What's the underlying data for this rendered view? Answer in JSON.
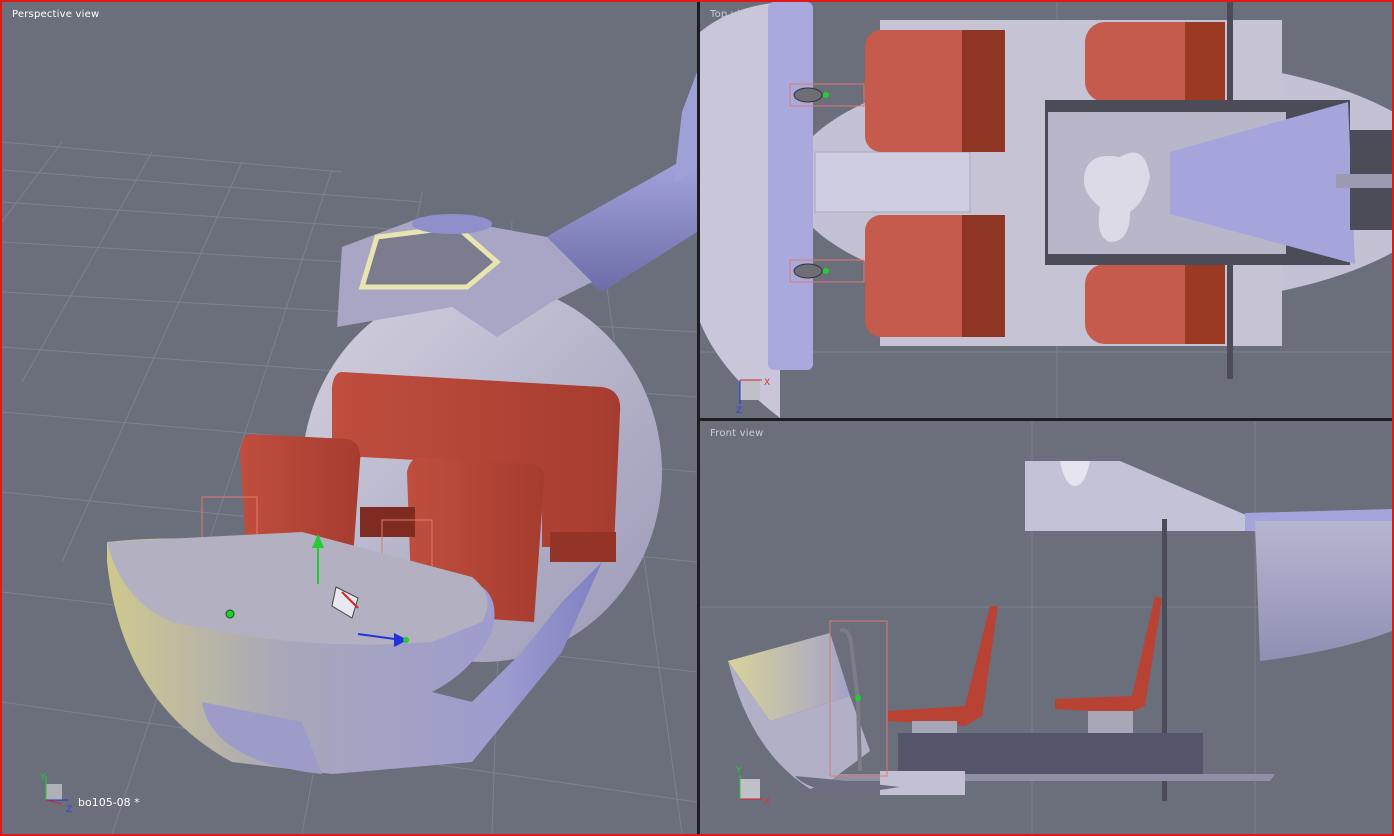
{
  "viewports": {
    "perspective": {
      "label": "Perspective view"
    },
    "top": {
      "label": "Top view"
    },
    "front": {
      "label": "Front view"
    }
  },
  "document": {
    "name": "bo105-08 *"
  },
  "axes": {
    "x": "X",
    "y": "Y",
    "z": "Z"
  },
  "colors": {
    "background": "#6b6f7b",
    "grid": "#7d818c",
    "border": "#e01818",
    "seat": "#b5473a",
    "hull": "#b9b6cc",
    "selection": "#e07a70",
    "pivot": "#22cc33"
  }
}
